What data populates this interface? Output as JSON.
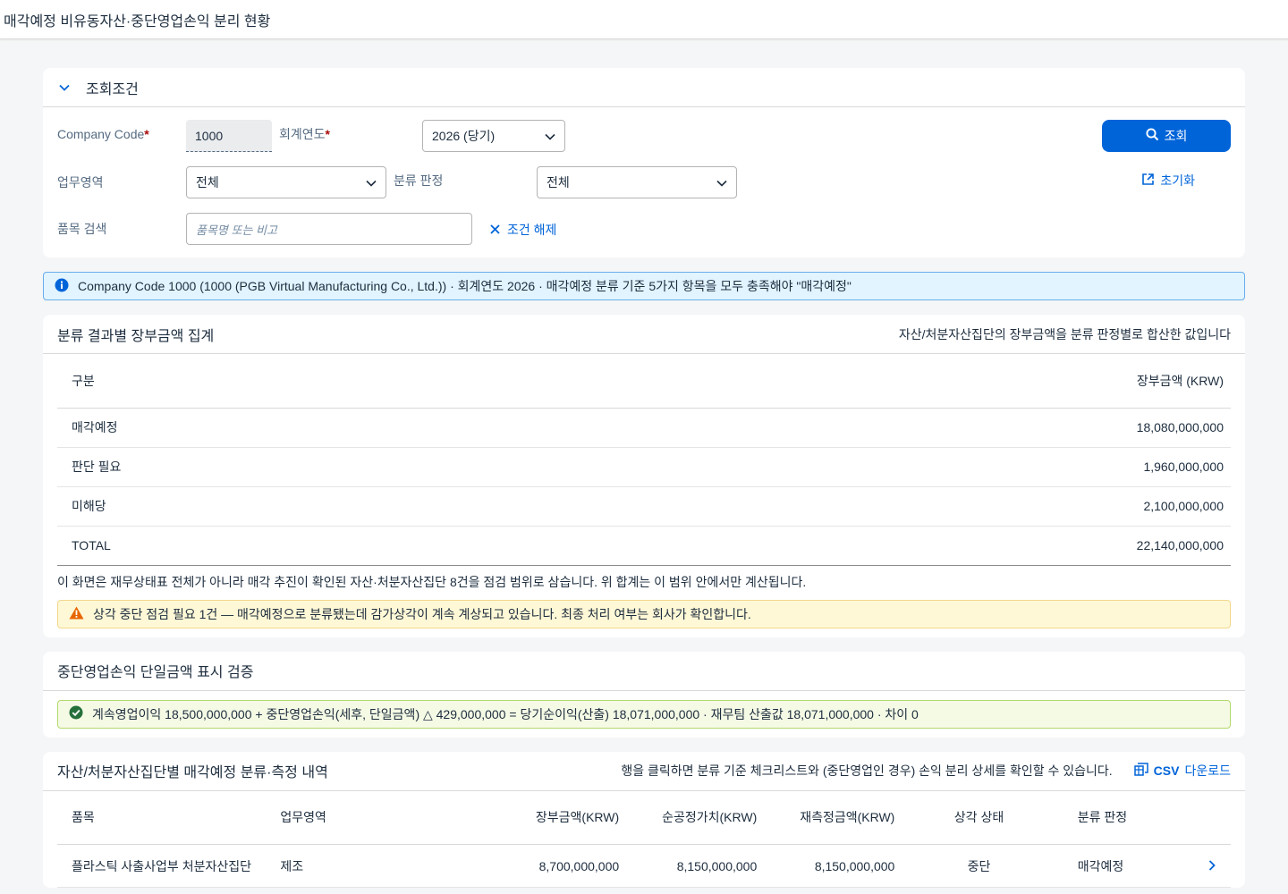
{
  "shell": {
    "title": "매각예정 비유동자산·중단영업손익 분리 현황"
  },
  "filter": {
    "title": "조회조건",
    "company_code_label": "Company Code",
    "company_code_value": "1000",
    "fiscal_year_label": "회계연도",
    "fiscal_year_value": "2026 (당기)",
    "business_area_label": "업무영역",
    "business_area_value": "전체",
    "classification_label": "분류 판정",
    "classification_value": "전체",
    "item_search_label": "품목 검색",
    "item_search_placeholder": "품목명 또는 비고",
    "clear_label": "조건 해제",
    "search_button_label": "조회",
    "reset_label": "초기화",
    "required_mark": "*"
  },
  "info": {
    "message": "Company Code 1000 (1000 (PGB Virtual Manufacturing Co., Ltd.)) · 회계연도 2026 · 매각예정 분류 기준 5가지 항목을 모두 충족해야 \"매각예정\""
  },
  "summary": {
    "title": "분류 결과별 장부금액 집계",
    "subtitle": "자산/처분자산집단의 장부금액을 분류 판정별로 합산한 값입니다",
    "col_category": "구분",
    "col_amount": "장부금액 (KRW)",
    "rows": [
      {
        "category": "매각예정",
        "amount": "18,080,000,000"
      },
      {
        "category": "판단 필요",
        "amount": "1,960,000,000"
      },
      {
        "category": "미해당",
        "amount": "2,100,000,000"
      },
      {
        "category": "TOTAL",
        "amount": "22,140,000,000"
      }
    ],
    "note": "이 화면은 재무상태표 전체가 아니라 매각 추진이 확인된 자산·처분자산집단 8건을 점검 범위로 삼습니다. 위 합계는 이 범위 안에서만 계산됩니다.",
    "warning": "상각 중단 점검 필요 1건 — 매각예정으로 분류됐는데 감가상각이 계속 계상되고 있습니다. 최종 처리 여부는 회사가 확인합니다."
  },
  "verify": {
    "title": "중단영업손익 단일금액 표시 검증",
    "message": "계속영업이익 18,500,000,000 + 중단영업손익(세후, 단일금액) △ 429,000,000 = 당기순이익(산출) 18,071,000,000 · 재무팀 산출값 18,071,000,000 · 차이 0"
  },
  "detail": {
    "title": "자산/처분자산집단별 매각예정 분류·측정 내역",
    "hint": "행을 클릭하면 분류 기준 체크리스트와 (중단영업인 경우) 손익 분리 상세를 확인할 수 있습니다.",
    "csv_prefix": "CSV",
    "csv_label": "다운로드",
    "columns": [
      "품목",
      "업무영역",
      "장부금액(KRW)",
      "순공정가치(KRW)",
      "재측정금액(KRW)",
      "상각 상태",
      "분류 판정"
    ],
    "rows": [
      {
        "item": "플라스틱 사출사업부 처분자산집단",
        "area": "제조",
        "book": "8,700,000,000",
        "fair": "8,150,000,000",
        "remeasured": "8,150,000,000",
        "depr": "중단",
        "result": "매각예정"
      }
    ]
  },
  "colors": {
    "brand": "#0064d9",
    "positive": "#256f3a",
    "required": "#aa0808",
    "info_bg": "#e1f4ff",
    "warning_bg": "#fff8d6",
    "success_bg": "#f5fae5"
  }
}
